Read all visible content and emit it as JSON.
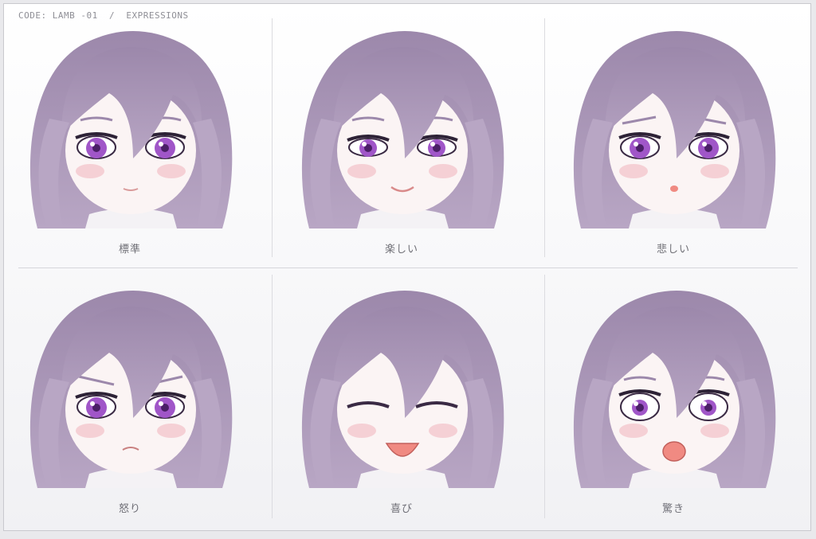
{
  "header": {
    "code": "CODE: LAMB -01  /  EXPRESSIONS"
  },
  "colors": {
    "hair": "#b8a6c4",
    "hair_dark": "#9c88ab",
    "skin": "#fbf4f4",
    "iris": "#a056c8",
    "blush": "#f2b8bf",
    "mouth": "#f08a82"
  },
  "expressions": [
    {
      "label": "標準",
      "mood": "neutral"
    },
    {
      "label": "楽しい",
      "mood": "happy"
    },
    {
      "label": "悲しい",
      "mood": "sad"
    },
    {
      "label": "怒り",
      "mood": "angry"
    },
    {
      "label": "喜び",
      "mood": "joy"
    },
    {
      "label": "驚き",
      "mood": "surprised"
    }
  ]
}
